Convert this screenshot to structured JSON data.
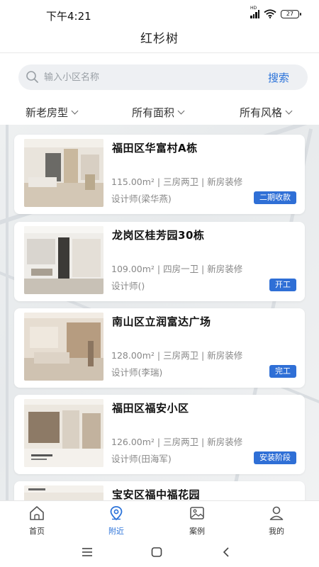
{
  "status_bar": {
    "time": "下午4:21",
    "network_label": "HD",
    "battery": "27"
  },
  "header": {
    "title": "红杉树"
  },
  "search": {
    "placeholder": "输入小区名称",
    "button_label": "搜索"
  },
  "filters": [
    {
      "label": "新老房型"
    },
    {
      "label": "所有面积"
    },
    {
      "label": "所有风格"
    }
  ],
  "listings": [
    {
      "title": "福田区华富村A栋",
      "meta": "115.00m² | 三房两卫 | 新房装修",
      "designer": "设计师(梁华燕)",
      "status": "二期收款"
    },
    {
      "title": "龙岗区桂芳园30栋",
      "meta": "109.00m² | 四房一卫 | 新房装修",
      "designer": "设计师()",
      "status": "开工"
    },
    {
      "title": "南山区立润富达广场",
      "meta": "128.00m² | 三房两卫 | 新房装修",
      "designer": "设计师(李瑞)",
      "status": "完工"
    },
    {
      "title": "福田区福安小区",
      "meta": "126.00m² | 三房两卫 | 新房装修",
      "designer": "设计师(田海军)",
      "status": "安装阶段"
    },
    {
      "title": "宝安区福中福花园",
      "meta": "",
      "designer": "",
      "status": ""
    }
  ],
  "tabbar": {
    "items": [
      {
        "label": "首页",
        "icon": "home-icon"
      },
      {
        "label": "附近",
        "icon": "location-pin-icon"
      },
      {
        "label": "案例",
        "icon": "image-icon"
      },
      {
        "label": "我的",
        "icon": "user-icon"
      }
    ],
    "active": "附近"
  },
  "colors": {
    "accent": "#2a72d9",
    "badge": "#2f6fd6",
    "search_bg": "#eef0f3"
  }
}
